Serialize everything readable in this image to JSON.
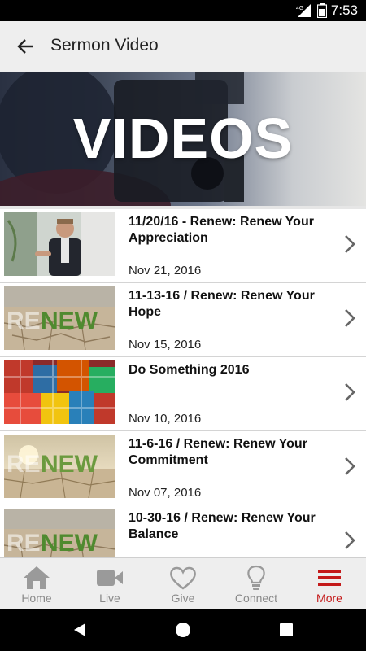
{
  "status_bar": {
    "network": "4G",
    "time": "7:53"
  },
  "app_bar": {
    "title": "Sermon Video",
    "back_icon": "arrow-back-icon"
  },
  "banner": {
    "text": "VIDEOS"
  },
  "sermons": [
    {
      "title": "11/20/16 - Renew: Renew Your Appreciation",
      "date": "Nov 21, 2016",
      "thumb": "speaker"
    },
    {
      "title": "11-13-16 / Renew: Renew Your Hope",
      "date": "Nov 15, 2016",
      "thumb": "renew-desert"
    },
    {
      "title": "Do Something 2016",
      "date": "Nov 10, 2016",
      "thumb": "gift-boxes"
    },
    {
      "title": "11-6-16 / Renew: Renew Your Commitment",
      "date": "Nov 07, 2016",
      "thumb": "renew-sunset"
    },
    {
      "title": "10-30-16 / Renew: Renew Your Balance",
      "date": "",
      "thumb": "renew-desert"
    }
  ],
  "tabs": [
    {
      "label": "Home",
      "icon": "home-icon"
    },
    {
      "label": "Live",
      "icon": "video-camera-icon"
    },
    {
      "label": "Give",
      "icon": "heart-icon"
    },
    {
      "label": "Connect",
      "icon": "lightbulb-icon"
    },
    {
      "label": "More",
      "icon": "menu-icon",
      "active": true
    }
  ],
  "colors": {
    "accent": "#c41a1a",
    "inactive_tab": "#8a8a8a",
    "app_bar": "#eeeeee"
  }
}
